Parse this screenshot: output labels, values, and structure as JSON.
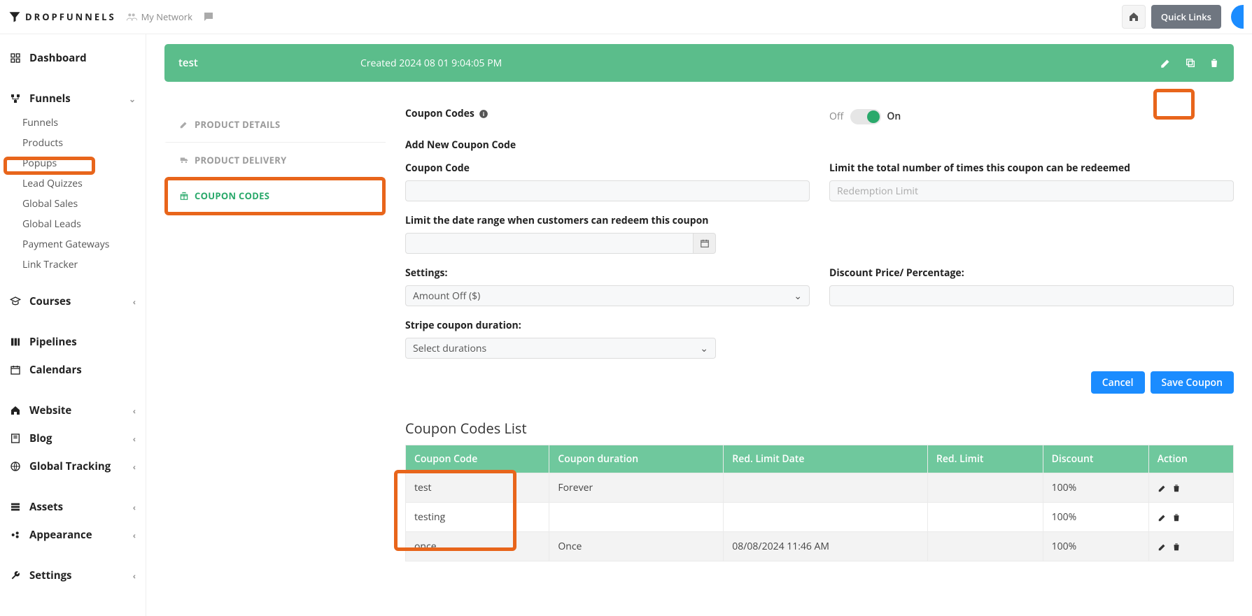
{
  "topbar": {
    "brand": "DROPFUNNELS",
    "my_network": "My Network",
    "quick_links": "Quick Links"
  },
  "sidebar": {
    "dashboard": "Dashboard",
    "funnels": "Funnels",
    "funnels_sub": [
      "Funnels",
      "Products",
      "Popups",
      "Lead Quizzes",
      "Global Sales",
      "Global Leads",
      "Payment Gateways",
      "Link Tracker"
    ],
    "courses": "Courses",
    "pipelines": "Pipelines",
    "calendars": "Calendars",
    "website": "Website",
    "blog": "Blog",
    "global_tracking": "Global Tracking",
    "assets": "Assets",
    "appearance": "Appearance",
    "settings": "Settings"
  },
  "header": {
    "name": "test",
    "created": "Created 2024 08 01 9:04:05 PM"
  },
  "tabs": {
    "product_details": "PRODUCT DETAILS",
    "product_delivery": "PRODUCT DELIVERY",
    "coupon_codes": "COUPON CODES"
  },
  "form": {
    "coupon_codes_title": "Coupon Codes",
    "toggle_off": "Off",
    "toggle_on": "On",
    "add_new": "Add New Coupon Code",
    "coupon_code_label": "Coupon Code",
    "limit_total_label": "Limit the total number of times this coupon can be redeemed",
    "redemption_limit_placeholder": "Redemption Limit",
    "limit_date_label": "Limit the date range when customers can redeem this coupon",
    "settings_label": "Settings:",
    "settings_value": "Amount Off ($)",
    "discount_label": "Discount Price/ Percentage:",
    "stripe_duration_label": "Stripe coupon duration:",
    "stripe_duration_value": "Select durations",
    "cancel": "Cancel",
    "save": "Save Coupon"
  },
  "list": {
    "title": "Coupon Codes List",
    "headers": [
      "Coupon Code",
      "Coupon duration",
      "Red. Limit Date",
      "Red. Limit",
      "Discount",
      "Action"
    ],
    "rows": [
      {
        "code": "test",
        "duration": "Forever",
        "limit_date": "",
        "limit": "",
        "discount": "100%"
      },
      {
        "code": "testing",
        "duration": "",
        "limit_date": "",
        "limit": "",
        "discount": "100%"
      },
      {
        "code": "once",
        "duration": "Once",
        "limit_date": "08/08/2024 11:46 AM",
        "limit": "",
        "discount": "100%"
      }
    ]
  }
}
